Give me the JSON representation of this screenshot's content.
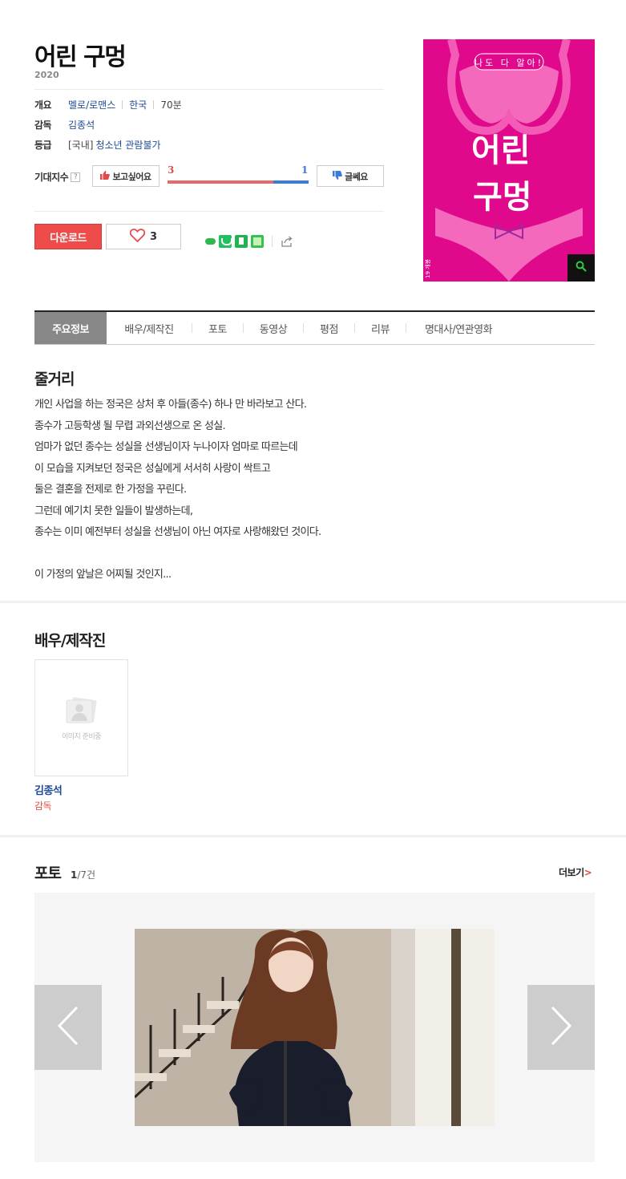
{
  "movie": {
    "title": "어린 구멍",
    "year": "2020"
  },
  "info": {
    "overview_label": "개요",
    "genre": "멜로/로맨스",
    "country": "한국",
    "runtime": "70분",
    "director_label": "감독",
    "director": "김종석",
    "rating_label": "등급",
    "rating_prefix": "[국내]",
    "rating": "청소년 관람불가"
  },
  "expectation": {
    "label": "기대지수",
    "help": "?",
    "want_label": "보고싶어요",
    "dislike_label": "글쎄요",
    "want_count": "3",
    "dislike_count": "1",
    "want_ratio": 0.75
  },
  "actions": {
    "download_label": "다운로드",
    "like_count": "3"
  },
  "poster": {
    "top_text": "나도 다 알아!",
    "title_line1": "어린",
    "title_line2": "구멍",
    "side_text": "19 개봉"
  },
  "tabs": [
    {
      "label": "주요정보",
      "active": true
    },
    {
      "label": "배우/제작진"
    },
    {
      "label": "포토"
    },
    {
      "label": "동영상"
    },
    {
      "label": "평점"
    },
    {
      "label": "리뷰"
    },
    {
      "label": "명대사/연관영화"
    }
  ],
  "synopsis": {
    "title": "줄거리",
    "lines": [
      "개인 사업을 하는 정국은 상처 후 아들(종수) 하나 만 바라보고 산다.",
      " 종수가 고등학생 될 무렵 과외선생으로 온 성실.",
      " 엄마가 없던 종수는 성실을 선생님이자 누나이자 엄마로 따르는데",
      " 이 모습을 지켜보던 정국은 성실에게 서서히 사랑이 싹트고",
      " 둘은 결혼을 전제로 한 가정을 꾸린다.",
      " 그런데 예기치 못한 일들이 발생하는데,",
      " 종수는 이미 예전부터 성실을 선생님이 아닌 여자로 사랑해왔던 것이다.",
      "",
      " 이 가정의 앞날은 어찌될 것인지..."
    ]
  },
  "cast": {
    "title": "배우/제작진",
    "placeholder_text": "이미지 준비중",
    "members": [
      {
        "name": "김종석",
        "role": "감독"
      }
    ]
  },
  "photo": {
    "title": "포토",
    "current": "1",
    "total": "/7건",
    "more_label": "더보기",
    "more_arrow": ">"
  },
  "colors": {
    "accent_red": "#ee4b4b",
    "link_blue": "#1d4a94",
    "poster_pink": "#e0098c"
  }
}
